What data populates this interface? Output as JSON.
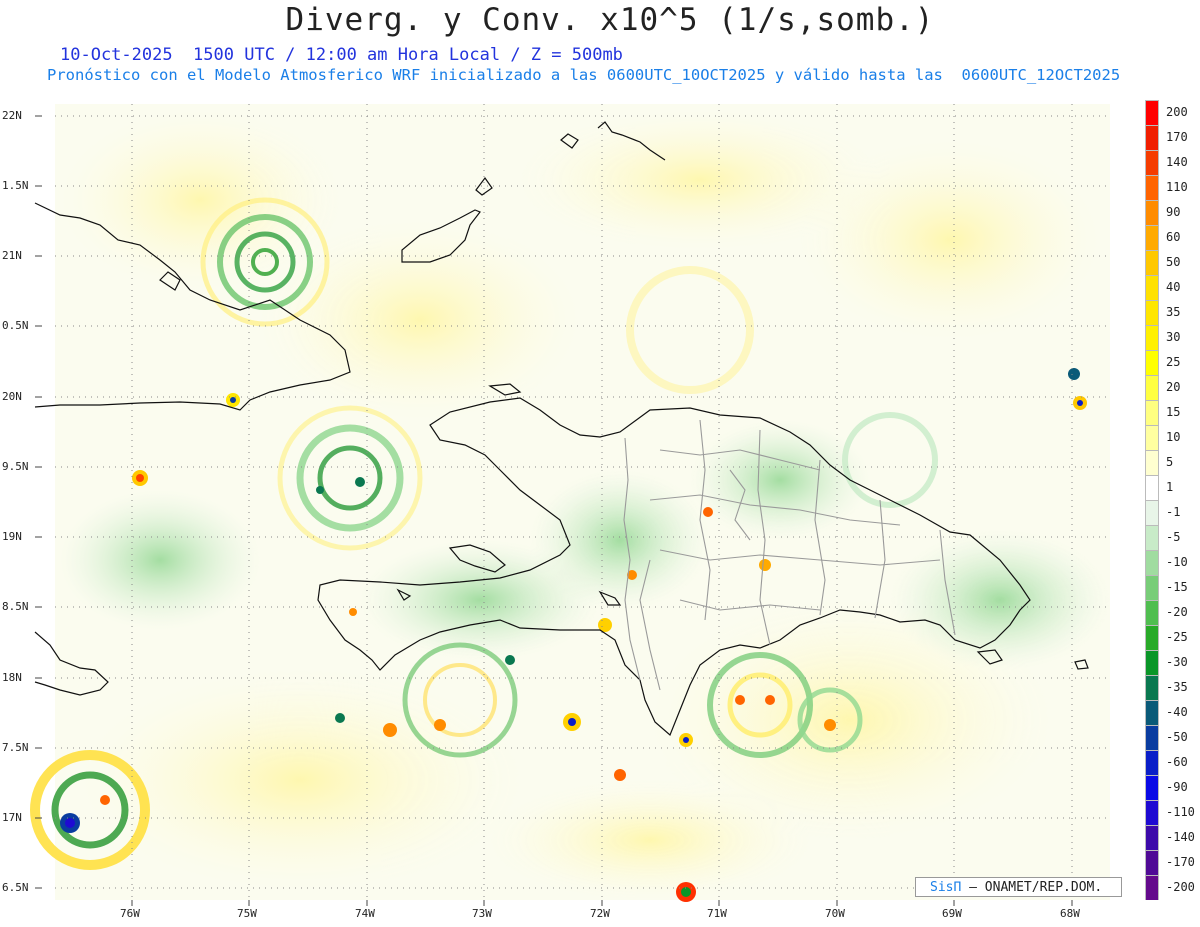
{
  "header": {
    "title": "Diverg. y Conv. x10^5 (1/s,somb.)",
    "subtitle_time": "10-Oct-2025  1500 UTC / 12:00 am Hora Local / Z = 500mb",
    "subtitle_model": "Pronóstico con el Modelo Atmosferico WRF inicializado a las 0600UTC_10OCT2025 y válido hasta las  0600UTC_12OCT2025"
  },
  "axes": {
    "lat_labels": [
      "22N",
      "1.5N",
      "21N",
      "0.5N",
      "20N",
      "9.5N",
      "19N",
      "8.5N",
      "18N",
      "7.5N",
      "17N",
      "6.5N"
    ],
    "lon_labels": [
      "76W",
      "75W",
      "74W",
      "73W",
      "72W",
      "71W",
      "70W",
      "69W",
      "68W"
    ]
  },
  "colorbar": {
    "labels": [
      "200",
      "170",
      "140",
      "110",
      "90",
      "60",
      "50",
      "40",
      "35",
      "30",
      "25",
      "20",
      "15",
      "10",
      "5",
      "1",
      "-1",
      "-5",
      "-10",
      "-15",
      "-20",
      "-25",
      "-30",
      "-35",
      "-40",
      "-50",
      "-60",
      "-90",
      "-110",
      "-140",
      "-170",
      "-200"
    ],
    "colors": [
      "#ff0000",
      "#f01e00",
      "#f53c00",
      "#ff6400",
      "#ff8c00",
      "#ffaa00",
      "#ffc800",
      "#ffe100",
      "#ffe600",
      "#fff000",
      "#ffff00",
      "#ffff40",
      "#ffff80",
      "#ffffa0",
      "#ffffd0",
      "#ffffff",
      "#e8f5e8",
      "#c8ebc8",
      "#a0dca0",
      "#78cd78",
      "#50be50",
      "#28aa28",
      "#0a9628",
      "#0a7850",
      "#0a5a78",
      "#0a3ca0",
      "#0a1ec8",
      "#0a0ae6",
      "#1e0ad2",
      "#3c0aaa",
      "#500a96",
      "#640a8c"
    ]
  },
  "credit": {
    "brand": "SisΠ",
    "text": "– ONAMET/REP.DOM."
  }
}
